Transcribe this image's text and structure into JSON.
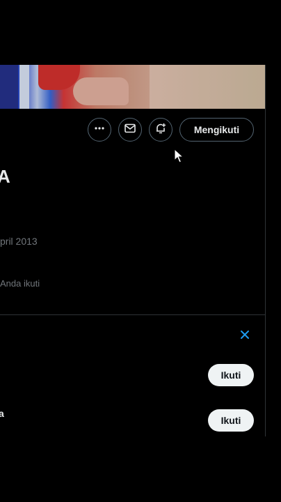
{
  "profile": {
    "name_fragment": "A",
    "joined": "pril 2013",
    "followed_by": "Anda ikuti"
  },
  "actions": {
    "more_icon": "more-horizontal-icon",
    "message_icon": "envelope-icon",
    "notify_icon": "bell-plus-icon",
    "following_label": "Mengikuti"
  },
  "suggestions": {
    "close_icon": "close-icon",
    "items": [
      {
        "name_fragment": "",
        "follow_label": "Ikuti"
      },
      {
        "name_fragment": "a",
        "follow_label": "Ikuti"
      }
    ]
  },
  "colors": {
    "accent": "#1d9bf0",
    "border": "#536471",
    "muted_text": "#71767b",
    "follow_bg": "#eff3f4"
  }
}
